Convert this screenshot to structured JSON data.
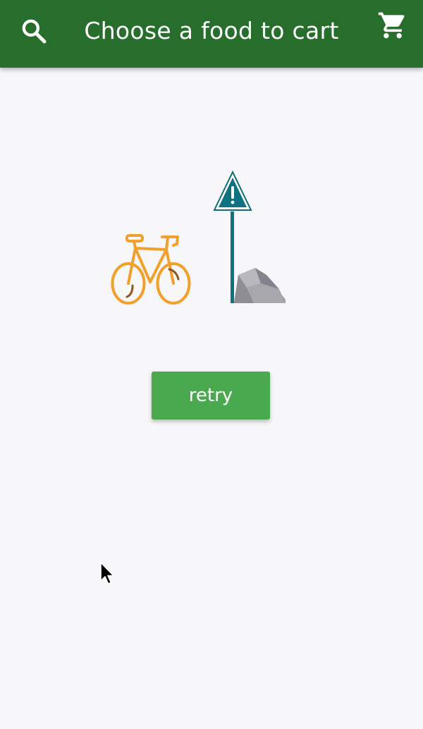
{
  "app_bar": {
    "title": "Choose a food to cart",
    "background_color": "#276e2d",
    "left_icon": "search-icon",
    "right_icon": "cart-icon"
  },
  "main": {
    "illustration": "bicycle-and-warning-sign-illustration",
    "retry_label": "retry",
    "retry_color": "#4aa84e"
  }
}
